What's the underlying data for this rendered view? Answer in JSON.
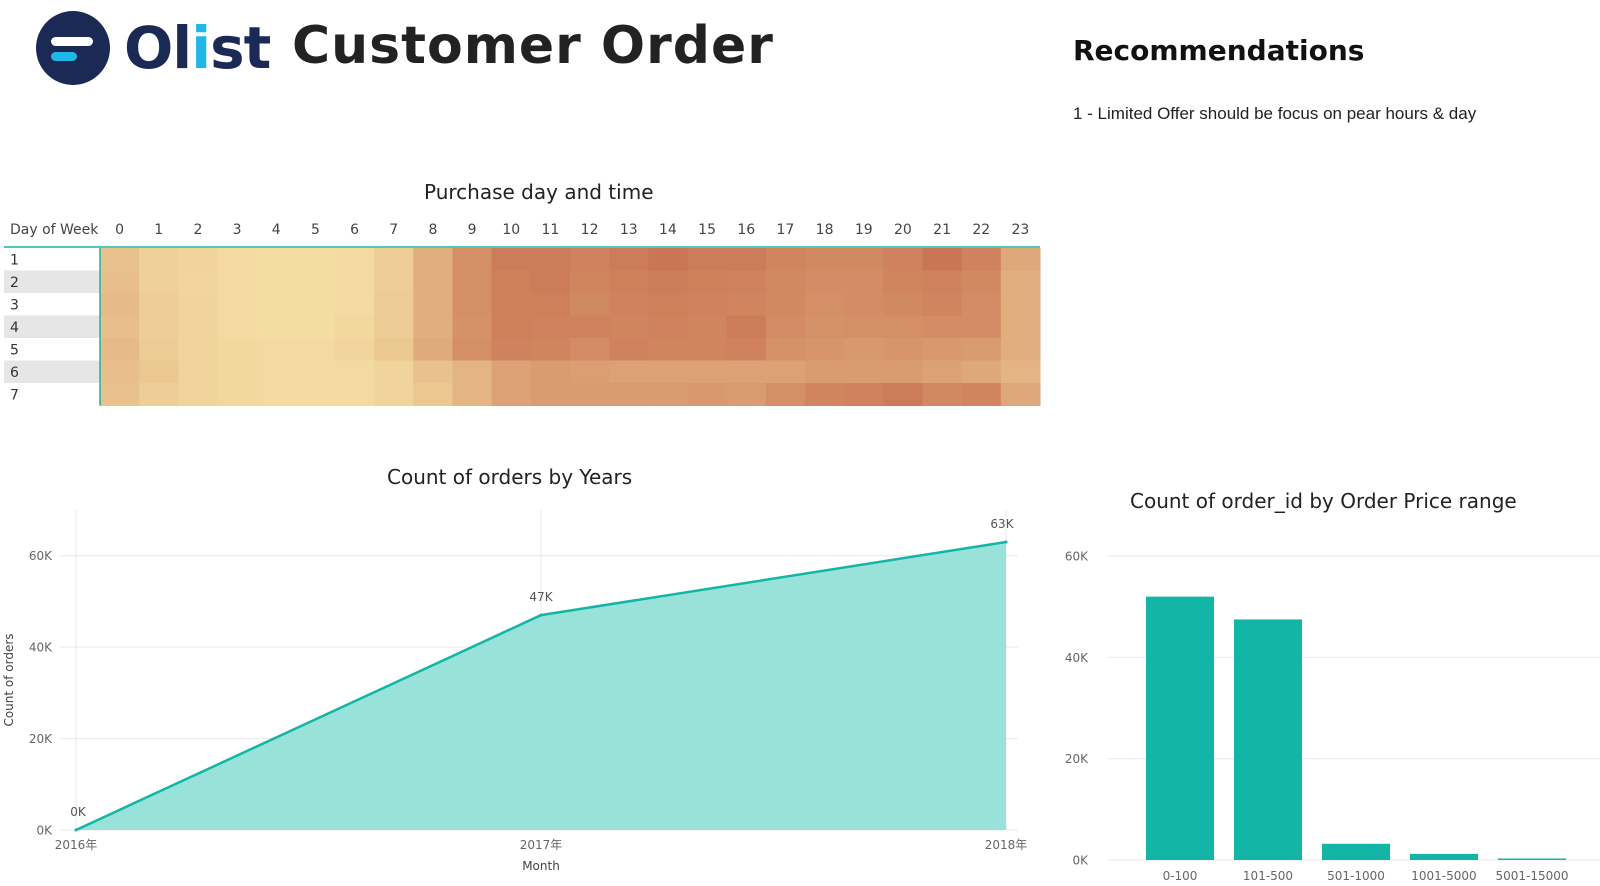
{
  "header": {
    "logo_text_pre": "Ol",
    "logo_text_i": "i",
    "logo_text_post": "st",
    "title": "Customer Order"
  },
  "recommendations": {
    "title": "Recommendations",
    "items": [
      "1 - Limited Offer should be focus on pear hours & day"
    ]
  },
  "colors": {
    "teal": "#12b5a6",
    "teal_fill": "#98e2d9",
    "heat_low": "#f9e7a9",
    "heat_high": "#c4694a",
    "row_stripe": "#e6e6e6",
    "grid": "#e8e8e8"
  },
  "chart_data": [
    {
      "type": "heatmap",
      "title": "Purchase day and time",
      "row_header": "Day of Week",
      "x": [
        "0",
        "1",
        "2",
        "3",
        "4",
        "5",
        "6",
        "7",
        "8",
        "9",
        "10",
        "11",
        "12",
        "13",
        "14",
        "15",
        "16",
        "17",
        "18",
        "19",
        "20",
        "21",
        "22",
        "23"
      ],
      "y": [
        "1",
        "2",
        "3",
        "4",
        "5",
        "6",
        "7"
      ],
      "values": [
        [
          0.3,
          0.18,
          0.15,
          0.1,
          0.08,
          0.08,
          0.1,
          0.2,
          0.45,
          0.7,
          0.85,
          0.85,
          0.8,
          0.85,
          0.9,
          0.85,
          0.85,
          0.78,
          0.75,
          0.75,
          0.8,
          0.9,
          0.8,
          0.5
        ],
        [
          0.32,
          0.18,
          0.14,
          0.1,
          0.08,
          0.08,
          0.1,
          0.2,
          0.45,
          0.7,
          0.82,
          0.85,
          0.78,
          0.82,
          0.85,
          0.82,
          0.8,
          0.75,
          0.72,
          0.72,
          0.78,
          0.8,
          0.75,
          0.45
        ],
        [
          0.35,
          0.2,
          0.15,
          0.1,
          0.08,
          0.08,
          0.1,
          0.22,
          0.45,
          0.7,
          0.82,
          0.82,
          0.75,
          0.8,
          0.82,
          0.8,
          0.78,
          0.75,
          0.7,
          0.72,
          0.75,
          0.78,
          0.72,
          0.45
        ],
        [
          0.32,
          0.2,
          0.15,
          0.1,
          0.08,
          0.08,
          0.12,
          0.22,
          0.45,
          0.68,
          0.82,
          0.8,
          0.8,
          0.78,
          0.8,
          0.78,
          0.85,
          0.72,
          0.68,
          0.7,
          0.7,
          0.72,
          0.72,
          0.45
        ],
        [
          0.35,
          0.22,
          0.15,
          0.12,
          0.1,
          0.1,
          0.14,
          0.25,
          0.48,
          0.7,
          0.8,
          0.78,
          0.72,
          0.8,
          0.78,
          0.78,
          0.8,
          0.68,
          0.65,
          0.62,
          0.65,
          0.62,
          0.6,
          0.45
        ],
        [
          0.32,
          0.25,
          0.15,
          0.12,
          0.1,
          0.1,
          0.1,
          0.15,
          0.3,
          0.4,
          0.55,
          0.6,
          0.58,
          0.55,
          0.55,
          0.55,
          0.55,
          0.55,
          0.6,
          0.6,
          0.6,
          0.55,
          0.5,
          0.4
        ],
        [
          0.3,
          0.2,
          0.15,
          0.12,
          0.1,
          0.1,
          0.1,
          0.15,
          0.25,
          0.4,
          0.55,
          0.6,
          0.6,
          0.6,
          0.6,
          0.62,
          0.6,
          0.7,
          0.78,
          0.8,
          0.85,
          0.75,
          0.78,
          0.5
        ]
      ]
    },
    {
      "type": "area",
      "title": "Count of orders by Years",
      "xlabel": "Month",
      "ylabel": "Count of orders",
      "x": [
        "2016年",
        "2017年",
        "2018年"
      ],
      "values": [
        0,
        47000,
        63000
      ],
      "data_labels": [
        "0K",
        "47K",
        "63K"
      ],
      "ylim": [
        0,
        70000
      ],
      "yticks": [
        0,
        20000,
        40000,
        60000
      ],
      "ytick_labels": [
        "0K",
        "20K",
        "40K",
        "60K"
      ],
      "grid": true
    },
    {
      "type": "bar",
      "title": "Count of order_id by Order Price range",
      "categories": [
        "0-100",
        "101-500",
        "501-1000",
        "1001-5000",
        "5001-15000"
      ],
      "values": [
        52000,
        47500,
        3200,
        1200,
        300
      ],
      "ylim": [
        0,
        62000
      ],
      "yticks": [
        0,
        20000,
        40000,
        60000
      ],
      "ytick_labels": [
        "0K",
        "20K",
        "40K",
        "60K"
      ],
      "grid": true
    }
  ]
}
